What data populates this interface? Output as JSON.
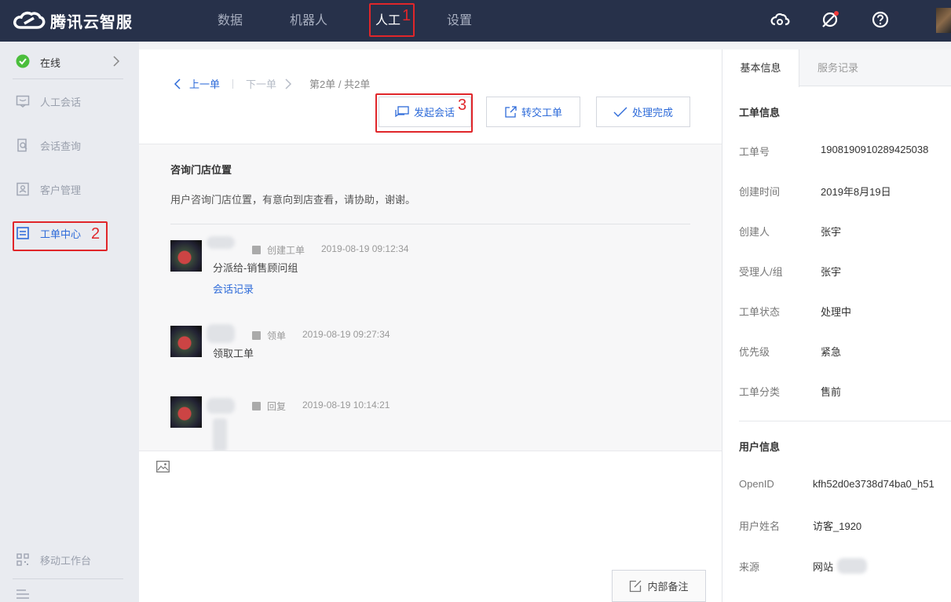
{
  "app": {
    "brand": "腾讯云智服"
  },
  "topnav": {
    "items": [
      {
        "label": "数据",
        "active": false
      },
      {
        "label": "机器人",
        "active": false
      },
      {
        "label": "人工",
        "active": true
      },
      {
        "label": "设置",
        "active": false
      }
    ],
    "icons": [
      "cloud-icon",
      "notification-off-icon",
      "help-icon"
    ]
  },
  "annotations": {
    "n1": "1",
    "n2": "2",
    "n3": "3"
  },
  "sidebar": {
    "status": "在线",
    "items": [
      {
        "label": "人工会话",
        "icon": "chat-icon"
      },
      {
        "label": "会话查询",
        "icon": "search-doc-icon"
      },
      {
        "label": "客户管理",
        "icon": "contacts-icon"
      },
      {
        "label": "工单中心",
        "icon": "ticket-icon",
        "active": true
      }
    ],
    "bottom_item": "移动工作台"
  },
  "pager": {
    "prev": "上一单",
    "next": "下一单",
    "count": "第2单 / 共2单"
  },
  "actions": {
    "start_chat": "发起会话",
    "transfer": "转交工单",
    "complete": "处理完成"
  },
  "ticket": {
    "title": "咨询门店位置",
    "description": "用户咨询门店位置，有意向到店查看，请协助，谢谢。",
    "logs": [
      {
        "type": "创建工单",
        "time": "2019-08-19 09:12:34",
        "text": "分派给-销售顾问组",
        "link": "会话记录"
      },
      {
        "type": "领单",
        "time": "2019-08-19 09:27:34",
        "text": "领取工单"
      },
      {
        "type": "回复",
        "time": "2019-08-19 10:14:21"
      }
    ]
  },
  "editor": {
    "note_button": "内部备注"
  },
  "right_panel": {
    "tabs": [
      "基本信息",
      "服务记录"
    ],
    "ticket_section": "工单信息",
    "ticket_fields": [
      {
        "label": "工单号",
        "value": "1908190910289425038"
      },
      {
        "label": "创建时间",
        "value": "2019年8月19日"
      },
      {
        "label": "创建人",
        "value": "张宇"
      },
      {
        "label": "受理人/组",
        "value": "张宇"
      },
      {
        "label": "工单状态",
        "value": "处理中"
      },
      {
        "label": "优先级",
        "value": "紧急"
      },
      {
        "label": "工单分类",
        "value": "售前"
      }
    ],
    "user_section": "用户信息",
    "user_fields": [
      {
        "label": "OpenID",
        "value": "kfh52d0e3738d74ba0_h51"
      },
      {
        "label": "用户姓名",
        "value": "访客_1920"
      },
      {
        "label": "来源",
        "value": "网站"
      }
    ]
  }
}
